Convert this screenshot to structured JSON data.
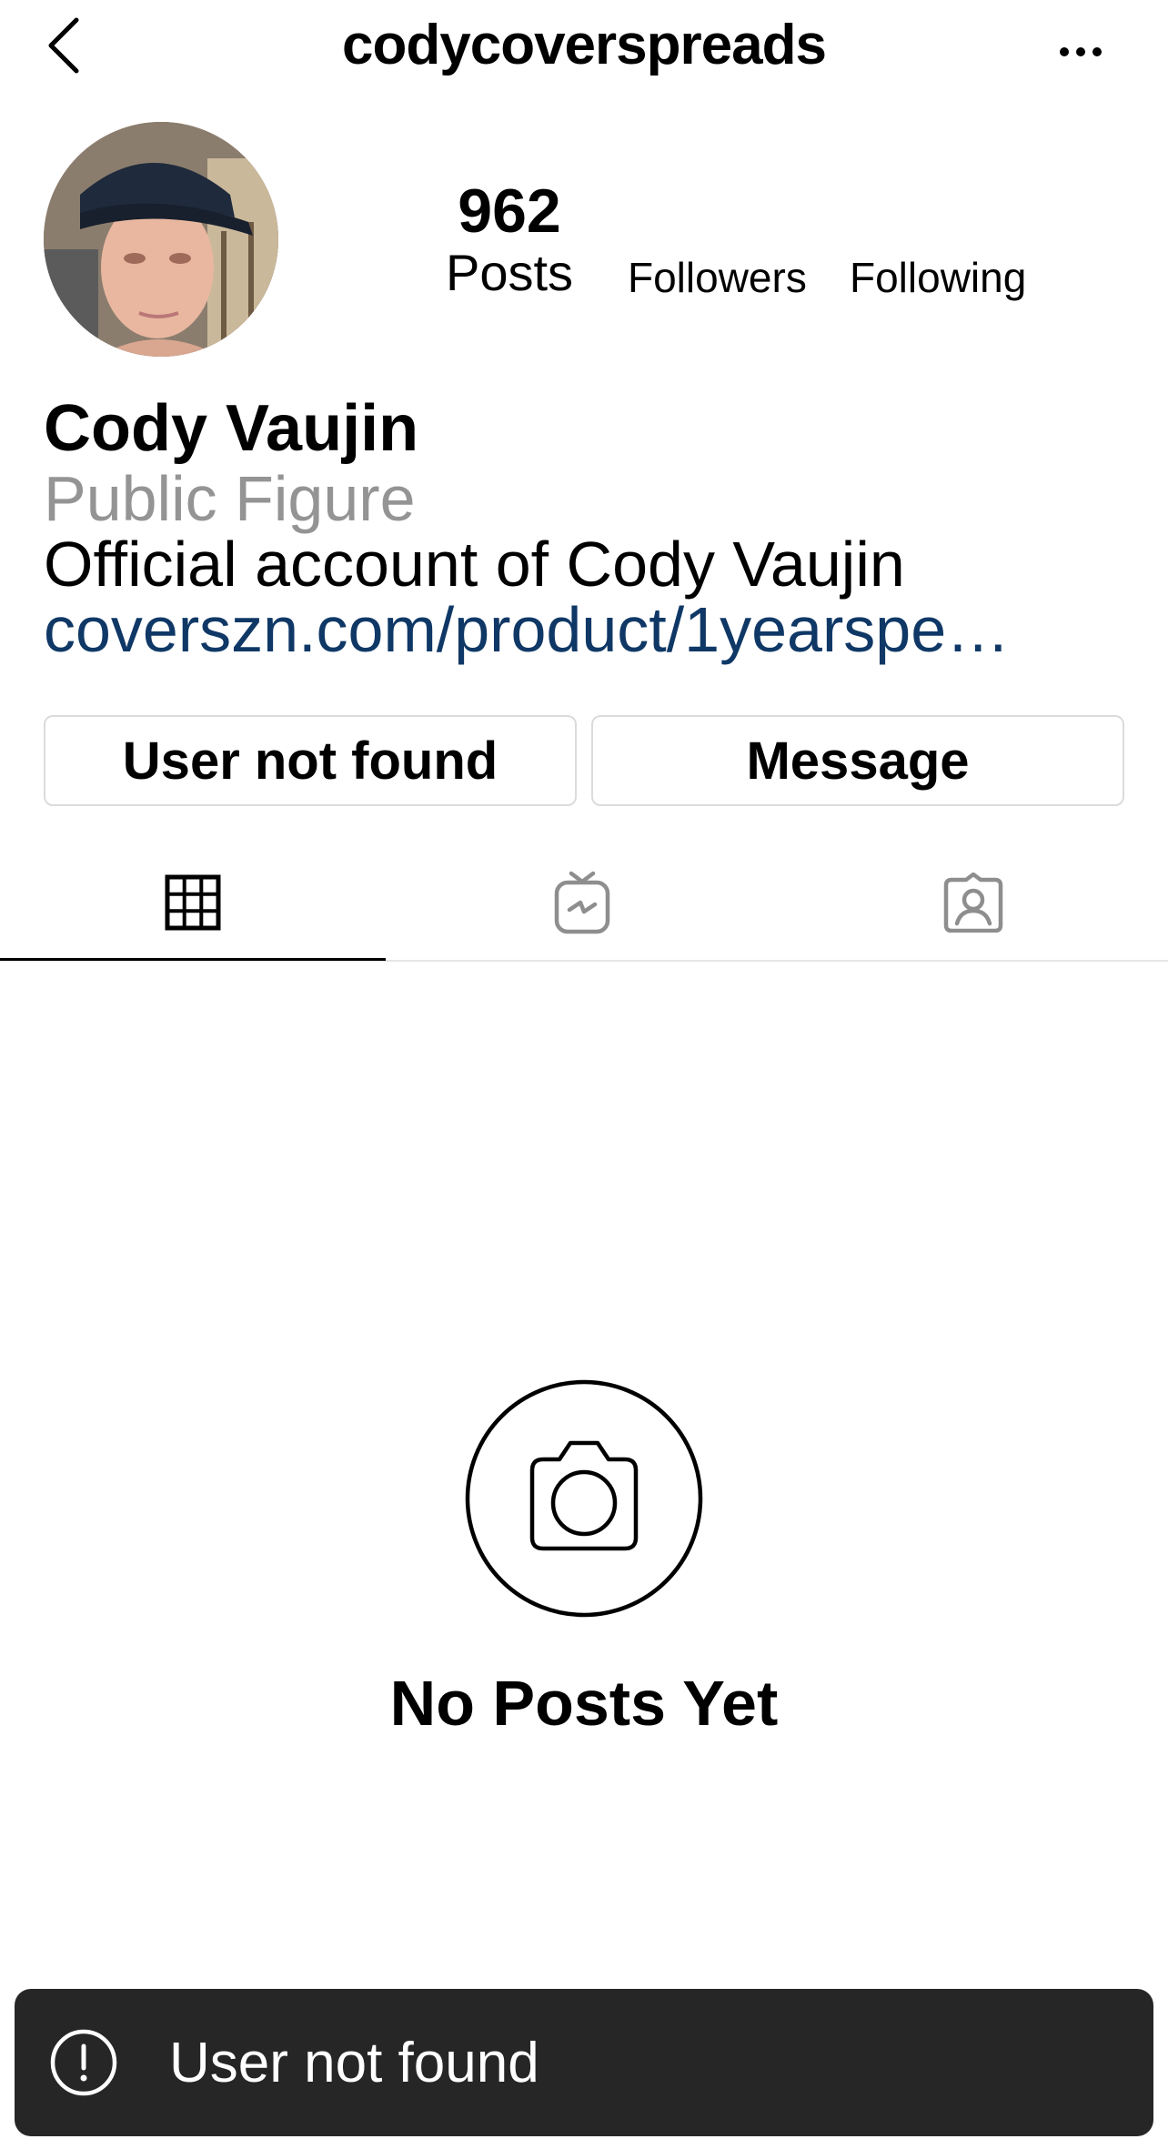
{
  "header": {
    "username": "codycoverspreads",
    "back_icon": "chevron-left-icon",
    "more_icon": "more-horizontal-icon"
  },
  "profile": {
    "avatar": "profile-photo",
    "stats": {
      "posts_count": "962",
      "posts_label": "Posts",
      "followers_label": "Followers",
      "following_label": "Following"
    },
    "bio": {
      "name": "Cody Vaujin",
      "category": "Public Figure",
      "text": "Official account of Cody Vaujin",
      "link": "coverszn.com/product/1yearspe…"
    }
  },
  "actions": {
    "primary_label": "User not found",
    "message_label": "Message"
  },
  "tabs": [
    {
      "icon": "grid-icon",
      "active": true
    },
    {
      "icon": "igtv-icon",
      "active": false
    },
    {
      "icon": "tagged-icon",
      "active": false
    }
  ],
  "empty_state": {
    "icon": "camera-icon",
    "text": "No Posts Yet"
  },
  "toast": {
    "icon": "alert-circle-icon",
    "text": "User not found"
  },
  "colors": {
    "link": "#0f3866",
    "category": "#949494",
    "toast_bg": "#262626",
    "border": "#dbdbdb"
  }
}
